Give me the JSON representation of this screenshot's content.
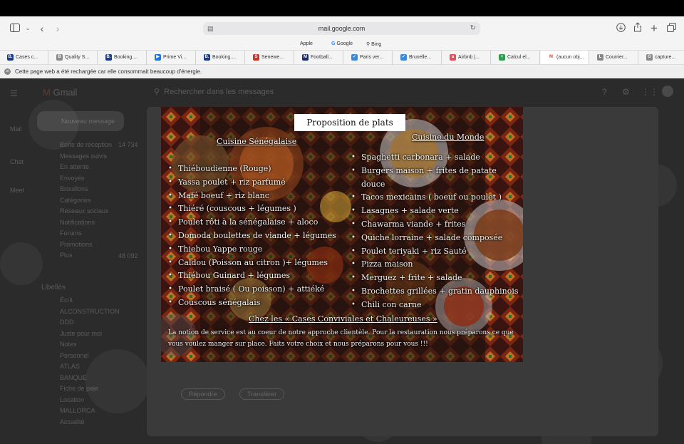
{
  "browser": {
    "url": "mail.google.com",
    "favorites": [
      "Apple",
      "Google",
      "Bing"
    ],
    "tabs": [
      {
        "label": "Cases c...",
        "badge": "B.",
        "color": "#1a3a8c"
      },
      {
        "label": "Quality S...",
        "badge": "B",
        "color": "#8a8a8a"
      },
      {
        "label": "Booking....",
        "badge": "B.",
        "color": "#1a3a8c"
      },
      {
        "label": "Prime Vi...",
        "badge": "▶",
        "color": "#1a73e8"
      },
      {
        "label": "Booking....",
        "badge": "B.",
        "color": "#1a3a8c"
      },
      {
        "label": "Senewe...",
        "badge": "S",
        "color": "#c0392b"
      },
      {
        "label": "Football...",
        "badge": "M",
        "color": "#1b2a6b"
      },
      {
        "label": "Paris ver...",
        "badge": "✓",
        "color": "#3b8ad9"
      },
      {
        "label": "Bruxelle...",
        "badge": "✓",
        "color": "#3b8ad9"
      },
      {
        "label": "Airbnb |...",
        "badge": "a",
        "color": "#e74c5c"
      },
      {
        "label": "Calcul el...",
        "badge": "+",
        "color": "#2e9e4f"
      },
      {
        "label": "(aucun obj...",
        "badge": "M",
        "color": "#ffffff",
        "active": true
      },
      {
        "label": "Courrier...",
        "badge": "L",
        "color": "#888888"
      },
      {
        "label": "capture...",
        "badge": "G",
        "color": "#888888"
      }
    ],
    "notice": "Cette page web a été rechargée car elle consommait beaucoup d'énergie."
  },
  "gmail_bg": {
    "app_name": "Gmail",
    "search_placeholder": "Rechercher dans les messages",
    "compose": "Nouveau message",
    "nav": [
      "Boîte de réception",
      "Messages suivis",
      "En attente",
      "Envoyés",
      "Brouillons",
      "Catégories",
      "Réseaux sociaux",
      "Notifications",
      "Forums",
      "Promotions",
      "Plus"
    ],
    "labels_head": "Libellés",
    "labels": [
      "Écrit",
      "ALCONSTRUCTION",
      "DDD",
      "Juste pour moi",
      "Notes",
      "Personnel",
      "ATLAS",
      "BANQUE",
      "Fiche de paie",
      "Location",
      "MALLORCA",
      "Actualité"
    ],
    "left_rail": [
      "Mail",
      "Chat",
      "Meet"
    ],
    "counts": [
      "14 734",
      "48 092"
    ],
    "reply": "Répondre",
    "forward": "Transférer"
  },
  "menu": {
    "title": "Proposition de plats",
    "col1_heading": "Cuisine Sénégalaise",
    "col1_items": [
      "Thiéboudienne (Rouge)",
      "Yassa poulet + riz parfumé",
      "Mafé boeuf + riz blanc",
      "Thiéré (couscous + légumes )",
      "Poulet rôti à la sénégalaise + aloco",
      "Domoda boulettes de viande + légumes",
      "Thiebou Yappe rouge",
      "Caldou (Poisson au citron )+ légumes",
      "Thiébou Guinard + légumes",
      "Poulet braisé ( Ou poisson) + attiéké",
      "Couscous sénégalais"
    ],
    "col2_heading": "Cuisine du Monde",
    "col2_items": [
      "Spaghetti carbonara + salade",
      "Burgers maison + frites de  patate douce",
      "Tacos mexicains ( boeuf ou poulet )",
      "Lasagnes + salade verte",
      "Chawarma viande + frites",
      "Quiche lorraine + salade composée",
      "Poulet teriyaki + riz Sauté",
      "Pizza maison",
      "Merguez + frite + salade",
      "Brochettes grillées + gratin dauphinois",
      "Chili con carne"
    ],
    "footer_heading": "Chez les « Cases Conviviales et Chaleureuses »",
    "footer_text": "La notion de service est au coeur de notre  approche clientèle. Pour la restauration nous préparons ce que vous voulez manger sur place. Faits votre choix et nous préparons pour vous !!!"
  }
}
